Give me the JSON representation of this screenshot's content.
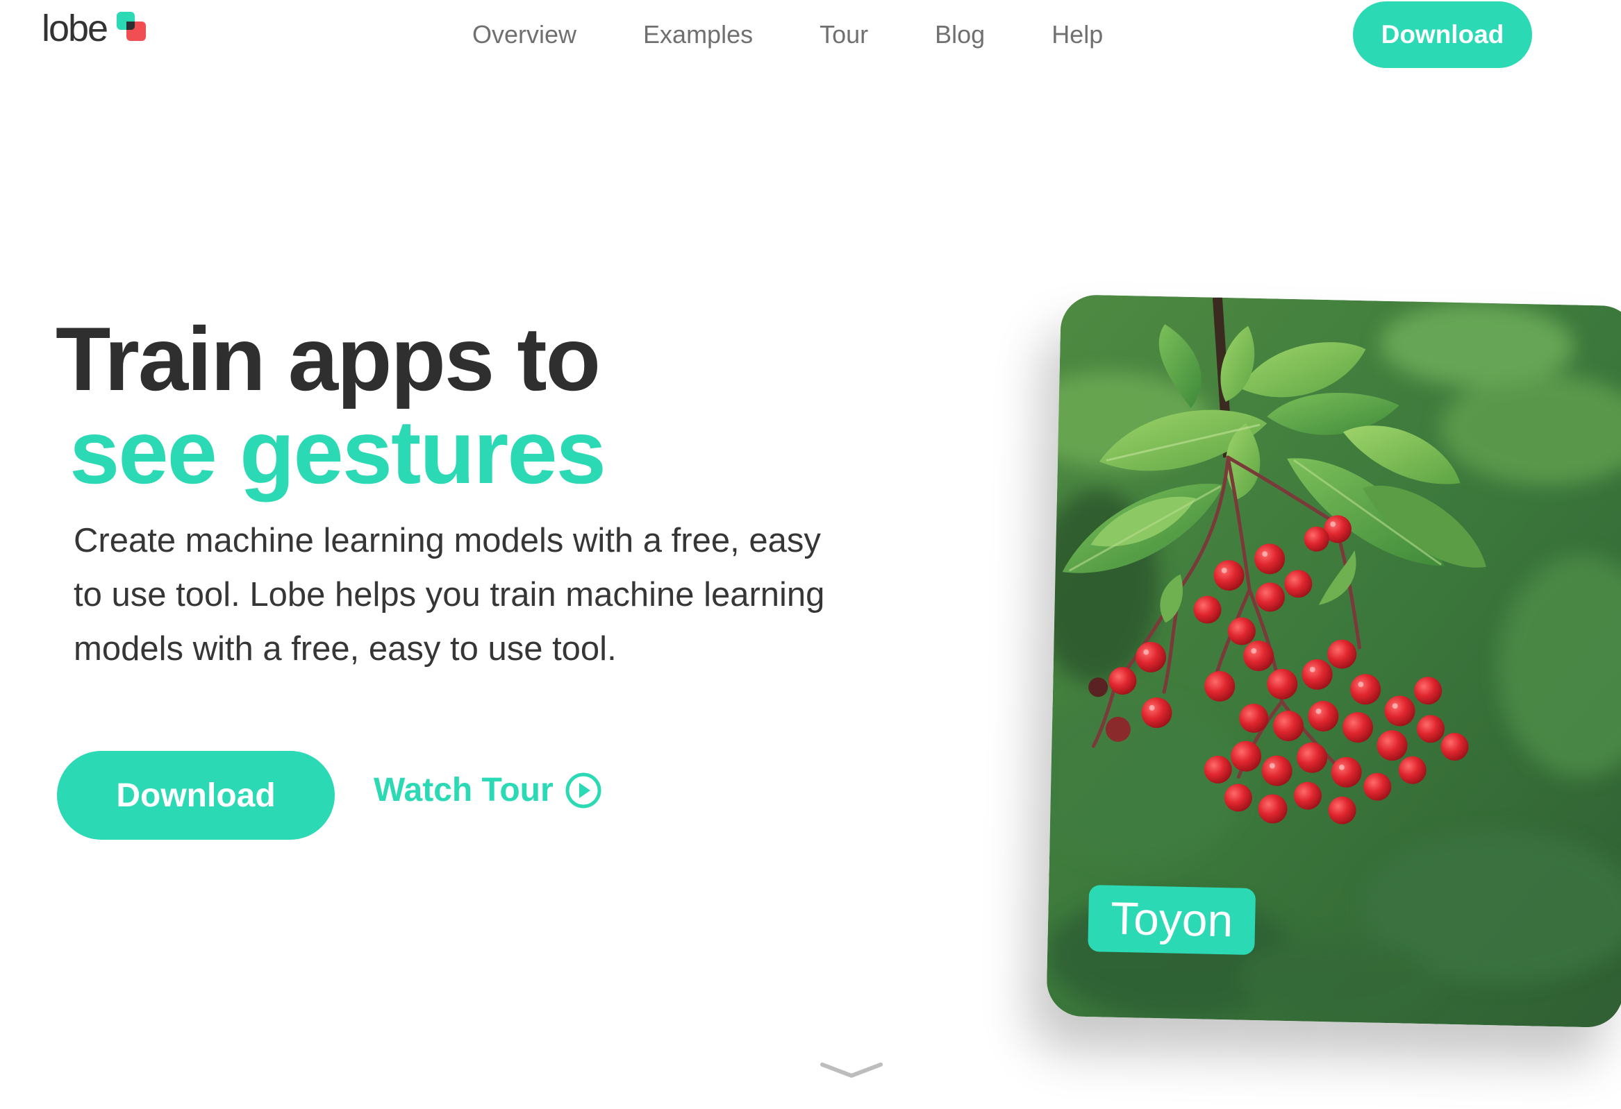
{
  "header": {
    "logo_text": "lobe",
    "nav": [
      {
        "label": "Overview"
      },
      {
        "label": "Examples"
      },
      {
        "label": "Tour"
      },
      {
        "label": "Blog"
      },
      {
        "label": "Help"
      }
    ],
    "download_label": "Download"
  },
  "hero": {
    "headline_line1": "Train apps to",
    "headline_line2": "see gestures",
    "description": "Create machine learning models with a free, easy to use tool. Lobe helps you train machine learning models with a free, easy to use tool.",
    "download_label": "Download",
    "watch_tour_label": "Watch Tour"
  },
  "card": {
    "label": "Toyon"
  },
  "colors": {
    "accent": "#2bd9b4",
    "logo_red": "#f04e52",
    "heading": "#2f2f2f",
    "nav_text": "#707070"
  },
  "icons": {
    "play": "play-circle-icon",
    "scroll": "chevron-down-icon"
  }
}
